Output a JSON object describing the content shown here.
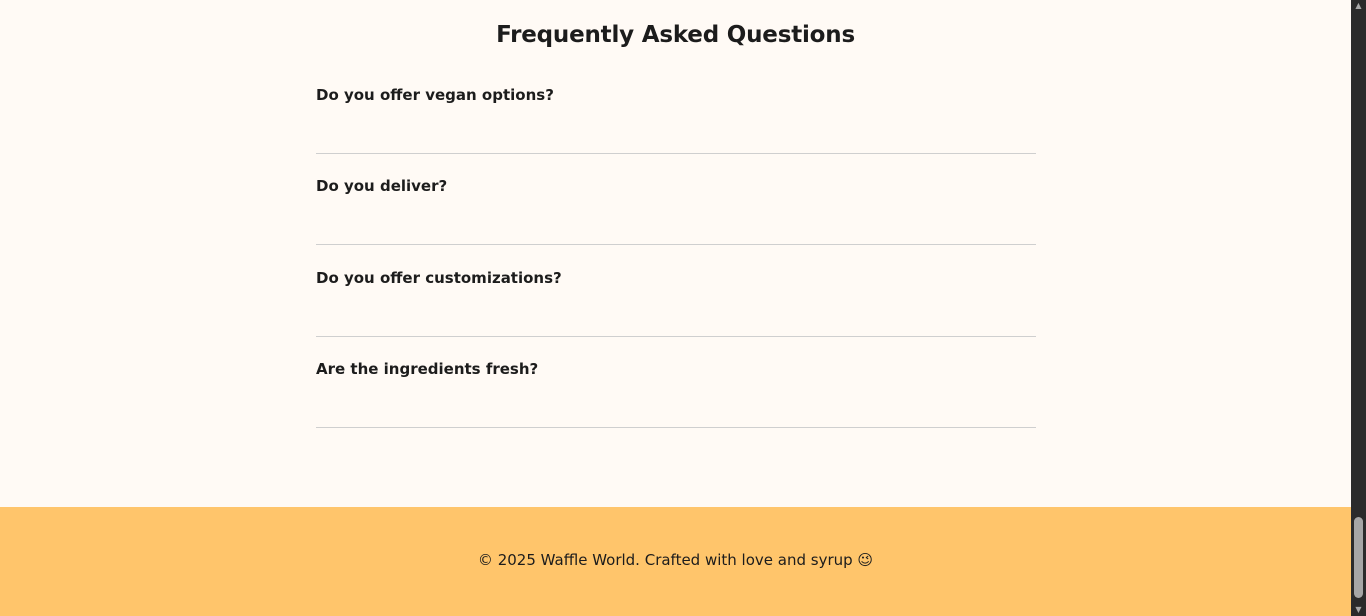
{
  "faq": {
    "title": "Frequently Asked Questions",
    "items": [
      {
        "question": "Do you offer vegan options?"
      },
      {
        "question": "Do you deliver?"
      },
      {
        "question": "Do you offer customizations?"
      },
      {
        "question": "Are the ingredients fresh?"
      }
    ]
  },
  "footer": {
    "text": "© 2025 Waffle World. Crafted with love and syrup 😉"
  },
  "colors": {
    "page_background": "#fffaf5",
    "footer_background": "#ffc56b",
    "divider": "#cfcfcf",
    "text": "#1c1c1c"
  },
  "scrollbar": {
    "up_arrow": "up-arrow-icon",
    "down_arrow": "down-arrow-icon"
  }
}
